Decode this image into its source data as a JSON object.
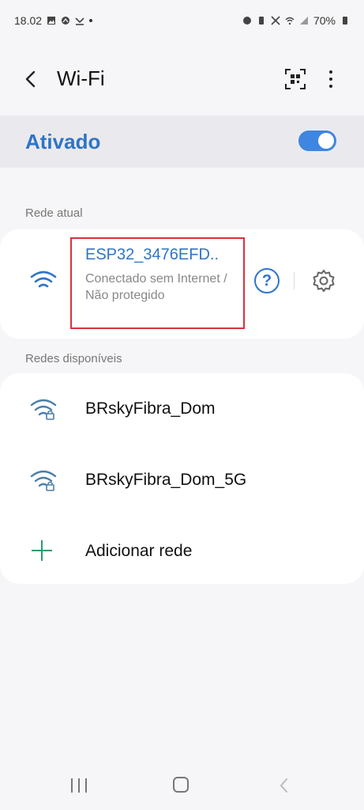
{
  "status_bar": {
    "time": "18.02",
    "battery": "70%"
  },
  "app_bar": {
    "title": "Wi-Fi"
  },
  "wifi_toggle": {
    "label": "Ativado",
    "enabled": true
  },
  "current_network": {
    "section_label": "Rede atual",
    "name": "ESP32_3476EFD..",
    "status": "Conectado sem Internet / Não protegido",
    "help_icon": "help-icon",
    "settings_icon": "gear-icon"
  },
  "available_networks": {
    "section_label": "Redes disponíveis",
    "items": [
      {
        "name": "BRskyFibra_Dom"
      },
      {
        "name": "BRskyFibra_Dom_5G"
      }
    ],
    "add_label": "Adicionar rede"
  },
  "colors": {
    "accent": "#2f74c8",
    "toggle_on": "#3e86e0",
    "add_icon": "#2f9b6a",
    "highlight": "#d9323c"
  }
}
